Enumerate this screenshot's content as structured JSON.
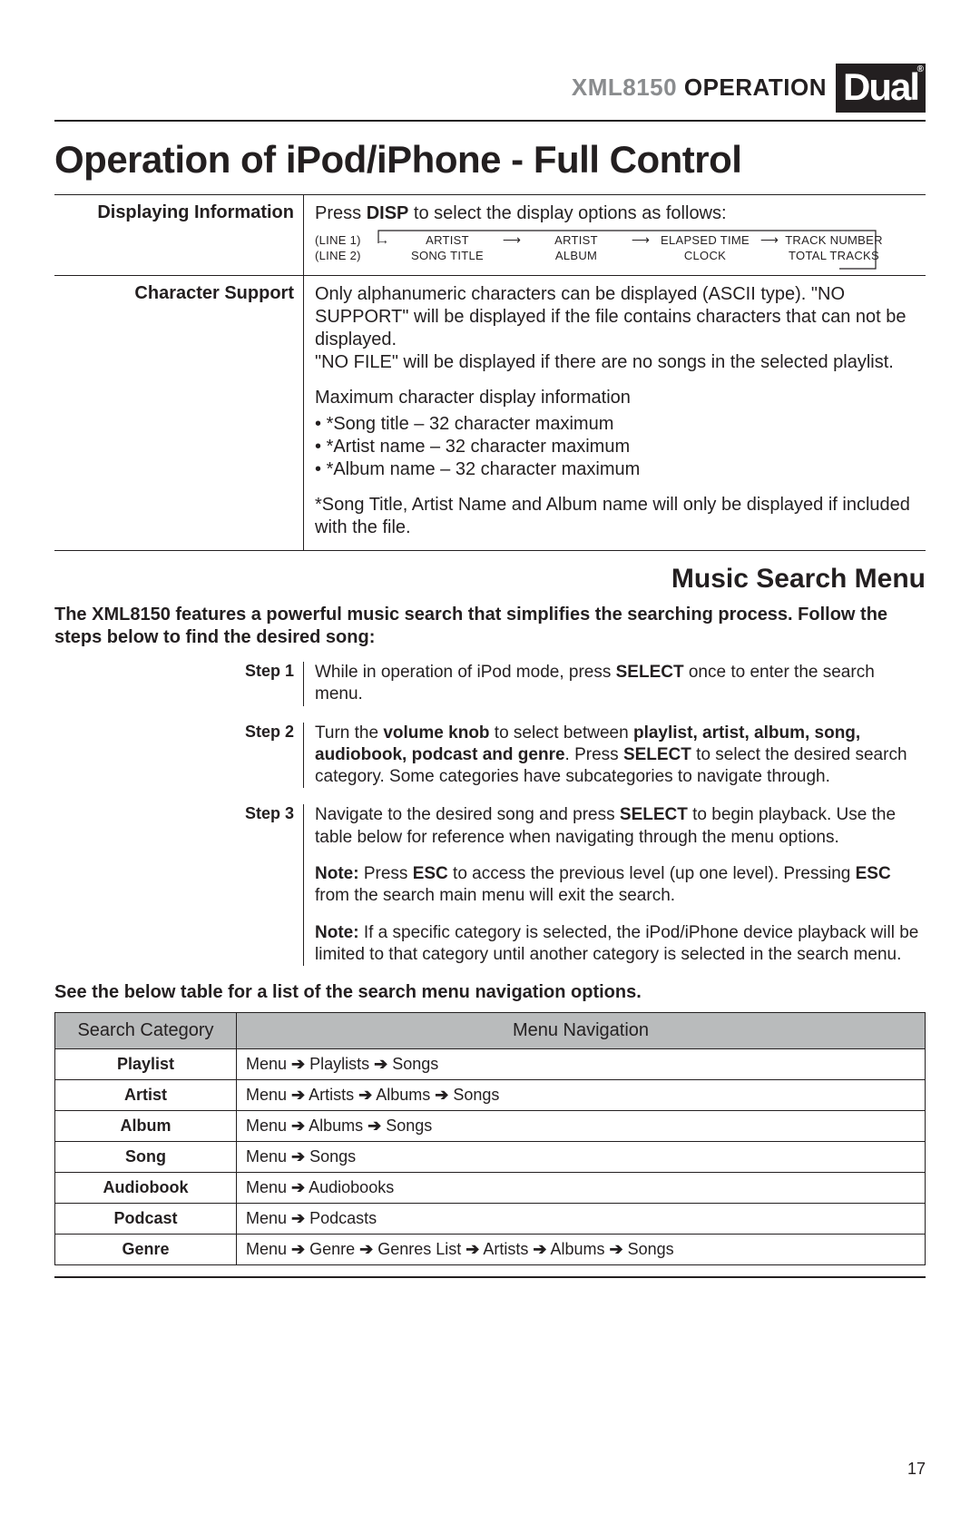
{
  "header": {
    "model": "XML8150",
    "operation": "OPERATION",
    "logo": "Dual"
  },
  "page_title": "Operation of iPod/iPhone - Full Control",
  "displaying_info": {
    "label": "Displaying Information",
    "intro_pre": "Press ",
    "intro_key": "DISP",
    "intro_post": " to select the display options as follows:",
    "line1_label": "(LINE 1)",
    "line2_label": "(LINE 2)",
    "cols": [
      {
        "top": "ARTIST",
        "bottom": "SONG TITLE"
      },
      {
        "top": "ARTIST",
        "bottom": "ALBUM"
      },
      {
        "top": "ELAPSED TIME",
        "bottom": "CLOCK"
      },
      {
        "top": "TRACK NUMBER",
        "bottom": "TOTAL TRACKS"
      }
    ]
  },
  "character_support": {
    "label": "Character Support",
    "para1": "Only alphanumeric characters can be displayed (ASCII type). \"NO SUPPORT\" will be displayed if the file contains characters that can not be displayed.",
    "para2": "\"NO FILE\" will be displayed if there are no songs in the selected playlist.",
    "max_heading": "Maximum character display information",
    "bullets": [
      "*Song title – 32 character maximum",
      "*Artist name – 32 character maximum",
      "*Album name – 32 character maximum"
    ],
    "footnote": "*Song Title, Artist Name and Album name will only be displayed if included with the file."
  },
  "music_search": {
    "heading": "Music Search Menu",
    "intro": "The XML8150 features a powerful music search that simplifies the searching process. Follow the steps below to find the desired song:",
    "steps": [
      {
        "label": "Step 1",
        "html": "While in operation of iPod mode, press <b>SELECT</b> once to enter the search menu."
      },
      {
        "label": "Step 2",
        "html": "Turn the <b>volume knob</b> to select between <b>playlist, artist, album, song, audiobook, podcast and genre</b>. Press <b>SELECT</b> to select the desired search category. Some categories have subcategories to navigate through."
      },
      {
        "label": "Step 3",
        "html": "Navigate to the desired song and press <b>SELECT</b> to begin playback. Use the table below for reference when navigating through the menu options.",
        "notes": [
          "<b>Note:</b> Press <b>ESC</b> to access the previous level (up one level). Pressing <b>ESC</b> from the search main menu will exit the search.",
          "<b>Note:</b> If a specific category is selected, the iPod/iPhone device playback will be limited to that category until another category is selected in the search menu."
        ]
      }
    ],
    "table_intro": "See the below table for a list of the search menu navigation options.",
    "table": {
      "headers": [
        "Search Category",
        "Menu Navigation"
      ],
      "rows": [
        {
          "cat": "Playlist",
          "nav": [
            "Menu",
            "Playlists",
            "Songs"
          ]
        },
        {
          "cat": "Artist",
          "nav": [
            "Menu",
            "Artists",
            "Albums",
            "Songs"
          ]
        },
        {
          "cat": "Album",
          "nav": [
            "Menu",
            "Albums",
            "Songs"
          ]
        },
        {
          "cat": "Song",
          "nav": [
            "Menu",
            "Songs"
          ]
        },
        {
          "cat": "Audiobook",
          "nav": [
            "Menu",
            "Audiobooks"
          ]
        },
        {
          "cat": "Podcast",
          "nav": [
            "Menu",
            "Podcasts"
          ]
        },
        {
          "cat": "Genre",
          "nav": [
            "Menu",
            "Genre",
            "Genres List",
            "Artists",
            "Albums",
            "Songs"
          ]
        }
      ]
    }
  },
  "page_number": "17"
}
